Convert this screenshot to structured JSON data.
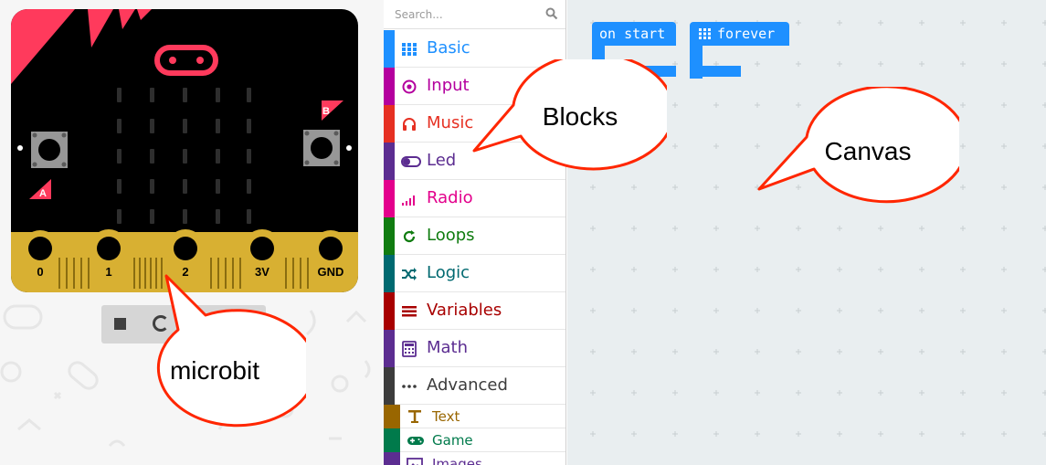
{
  "simulator": {
    "pins": [
      "0",
      "1",
      "2",
      "3V",
      "GND"
    ],
    "button_a_label": "A",
    "button_b_label": "B"
  },
  "toolbox": {
    "search_placeholder": "Search...",
    "categories": [
      {
        "label": "Basic",
        "icon": "grid-icon",
        "color": "#1e90ff"
      },
      {
        "label": "Input",
        "icon": "target-icon",
        "color": "#b4009e"
      },
      {
        "label": "Music",
        "icon": "headphones-icon",
        "color": "#e63022"
      },
      {
        "label": "Led",
        "icon": "toggle-icon",
        "color": "#5c2d91"
      },
      {
        "label": "Radio",
        "icon": "signal-bars-icon",
        "color": "#e3008c"
      },
      {
        "label": "Loops",
        "icon": "refresh-icon",
        "color": "#107c10"
      },
      {
        "label": "Logic",
        "icon": "shuffle-icon",
        "color": "#006970"
      },
      {
        "label": "Variables",
        "icon": "list-icon",
        "color": "#a80000"
      },
      {
        "label": "Math",
        "icon": "calculator-icon",
        "color": "#5c2d91"
      },
      {
        "label": "Advanced",
        "icon": "ellipsis-icon",
        "color": "#3c3c3c"
      }
    ],
    "subcategories": [
      {
        "label": "Text",
        "icon": "text-icon",
        "color": "#996600"
      },
      {
        "label": "Game",
        "icon": "gamepad-icon",
        "color": "#007a4b"
      },
      {
        "label": "Images",
        "icon": "image-icon",
        "color": "#5c2d91"
      }
    ]
  },
  "canvas": {
    "blocks": [
      {
        "label": "on start",
        "icon": "none"
      },
      {
        "label": "forever",
        "icon": "grid-icon"
      }
    ]
  },
  "callouts": {
    "microbit": "microbit",
    "blocks": "Blocks",
    "canvas": "Canvas"
  },
  "colors": {
    "board": "#000000",
    "board_accent": "#ff3a5c",
    "pin_gold": "#d8b032",
    "block_blue": "#1e90ff",
    "canvas_bg": "#e9eef0",
    "callout_stroke": "#ff2600"
  }
}
